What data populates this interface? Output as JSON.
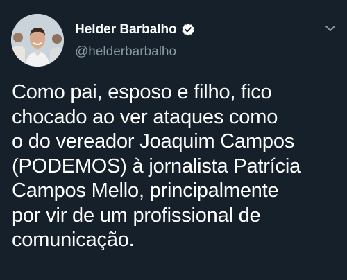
{
  "tweet": {
    "author": {
      "display_name": "Helder Barbalho",
      "handle": "@helderbarbalho",
      "verified_icon": "verified-badge-icon",
      "avatar": "profile-photo"
    },
    "menu_icon": "chevron-down-icon",
    "text_lines": [
      "Como pai, esposo e filho, fico",
      "chocado ao ver ataques como",
      "o do vereador Joaquim Campos",
      "(PODEMOS) à jornalista Patrícia",
      "Campos Mello, principalmente",
      "por vir de um profissional de",
      "comunicação."
    ]
  },
  "colors": {
    "background": "#15202b",
    "text": "#ffffff",
    "secondary_text": "#8899a6"
  }
}
